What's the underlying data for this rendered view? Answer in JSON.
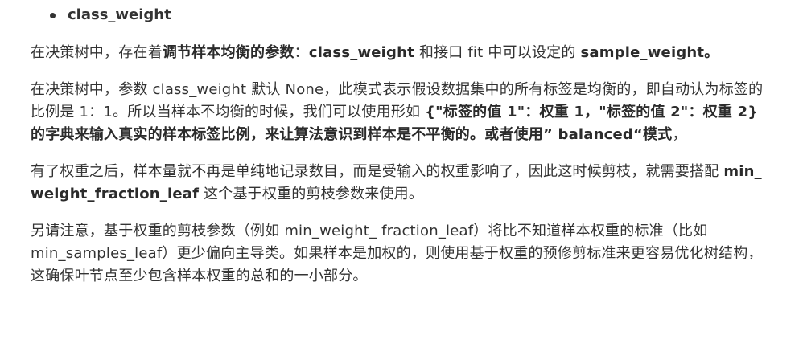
{
  "heading": {
    "bullet_label": "class_weight"
  },
  "p1": {
    "t1": "在决策树中，存在着",
    "b1": "调节样本均衡的参数",
    "t2": "：",
    "b2": "class_weight",
    "t3": " 和接口 fit 中可以设定的 ",
    "b3": "sample_weight。"
  },
  "p2": {
    "t1": "在决策树中，参数 class_weight 默认 None，此模式表示假设数据集中的所有标签是均衡的，即自动认为标签的比例是 1：1。所以当样本不均衡的时候，我们可以使用形如 ",
    "b1": "{\"标签的值 1\"：权重 1，\"标签的值 2\"：权重 2} 的字典来输入真实的样本标签比例，来让算法意识到样本是不平衡的。或者使用” balanced“模式",
    "t2": "，"
  },
  "p3": {
    "t1": "有了权重之后，样本量就不再是单纯地记录数目，而是受输入的权重影响了，因此这时候剪枝，就需要搭配 ",
    "b1": "min_ weight_fraction_leaf",
    "t2": " 这个基于权重的剪枝参数来使用。"
  },
  "p4": {
    "t1": "另请注意，基于权重的剪枝参数（例如 min_weight_ fraction_leaf）将比不知道样本权重的标准（比如 min_samples_leaf）更少偏向主导类。如果样本是加权的，则使用基于权重的预修剪标准来更容易优化树结构，这确保叶节点至少包含样本权重的总和的一小部分。"
  }
}
